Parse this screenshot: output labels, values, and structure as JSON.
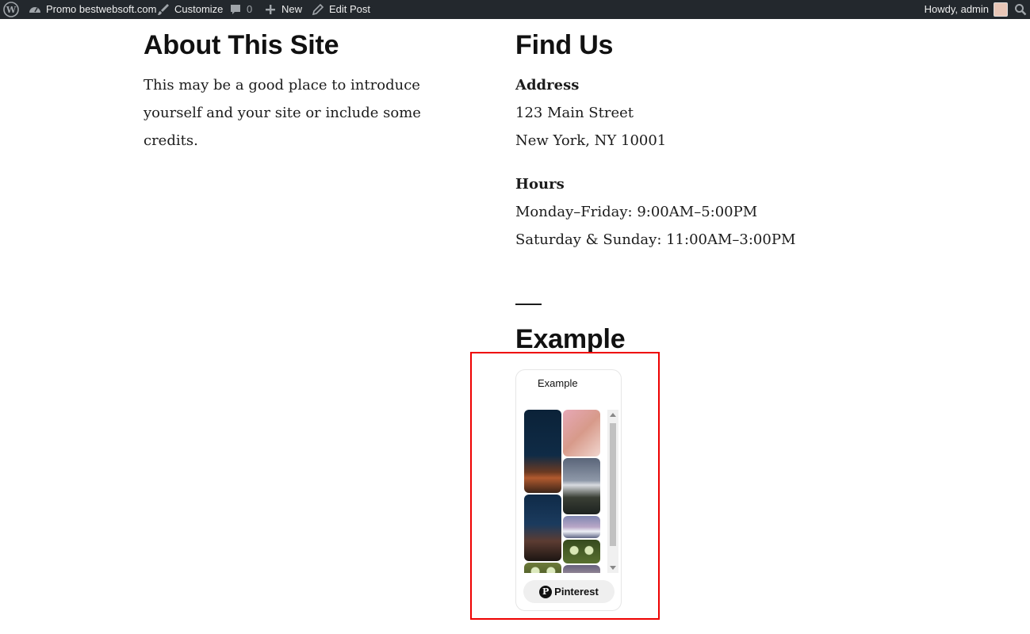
{
  "admin_bar": {
    "site_name": "Promo bestwebsoft.com",
    "customize": "Customize",
    "comments_count": "0",
    "new": "New",
    "edit_post": "Edit Post",
    "howdy": "Howdy, admin"
  },
  "about": {
    "title": "About This Site",
    "text": "This may be a good place to introduce yourself and your site or include some credits."
  },
  "find_us": {
    "title": "Find Us",
    "address_label": "Address",
    "address_line1": "123 Main Street",
    "address_line2": "New York, NY 10001",
    "hours_label": "Hours",
    "hours_line1": "Monday–Friday: 9:00AM–5:00PM",
    "hours_line2": "Saturday & Sunday: 11:00AM–3:00PM"
  },
  "example": {
    "title": "Example",
    "board_title": "Example",
    "button_label": "Pinterest"
  },
  "colors": {
    "admin_bar_bg": "#23282d",
    "highlight": "#e00000"
  }
}
